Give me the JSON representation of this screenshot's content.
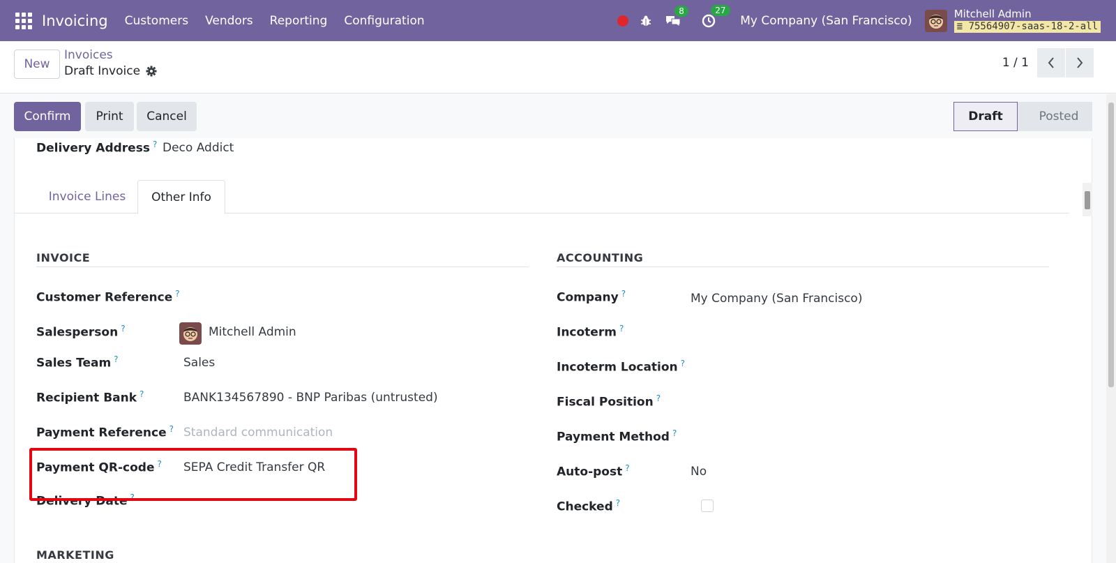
{
  "navbar": {
    "brand": "Invoicing",
    "menu": [
      "Customers",
      "Vendors",
      "Reporting",
      "Configuration"
    ],
    "messages_count": "8",
    "activities_count": "27",
    "company": "My Company (San Francisco)",
    "user_name": "Mitchell Admin",
    "db_name": "75564907-saas-18-2-all",
    "colors": {
      "bar": "#71639e",
      "badge": "#27a844",
      "record": "#e0262c"
    }
  },
  "control": {
    "new_label": "New",
    "breadcrumb_parent": "Invoices",
    "breadcrumb_current": "Draft Invoice",
    "pager": "1 / 1"
  },
  "statusbar": {
    "confirm": "Confirm",
    "print": "Print",
    "cancel": "Cancel",
    "stages": [
      "Draft",
      "Posted"
    ],
    "active_stage": "Draft"
  },
  "form": {
    "delivery_address_label": "Delivery Address",
    "delivery_address_value": "Deco Addict",
    "help_mark": "?",
    "tabs": [
      "Invoice Lines",
      "Other Info"
    ],
    "active_tab": "Other Info",
    "invoice_section": "INVOICE",
    "accounting_section": "ACCOUNTING",
    "customer_reference_label": "Customer Reference",
    "salesperson_label": "Salesperson",
    "salesperson_value": "Mitchell Admin",
    "sales_team_label": "Sales Team",
    "sales_team_value": "Sales",
    "recipient_bank_label": "Recipient Bank",
    "recipient_bank_value": "BANK134567890 - BNP Paribas (untrusted)",
    "payment_reference_label": "Payment Reference",
    "payment_reference_placeholder": "Standard communication",
    "payment_qr_label": "Payment QR-code",
    "payment_qr_value": "SEPA Credit Transfer QR",
    "delivery_date_label": "Delivery Date",
    "marketing_section": "MARKETING",
    "company_label": "Company",
    "company_value": "My Company (San Francisco)",
    "incoterm_label": "Incoterm",
    "incoterm_location_label": "Incoterm Location",
    "fiscal_position_label": "Fiscal Position",
    "payment_method_label": "Payment Method",
    "auto_post_label": "Auto-post",
    "auto_post_value": "No",
    "checked_label": "Checked",
    "checked_value": false
  },
  "highlight_color": "#e30613"
}
